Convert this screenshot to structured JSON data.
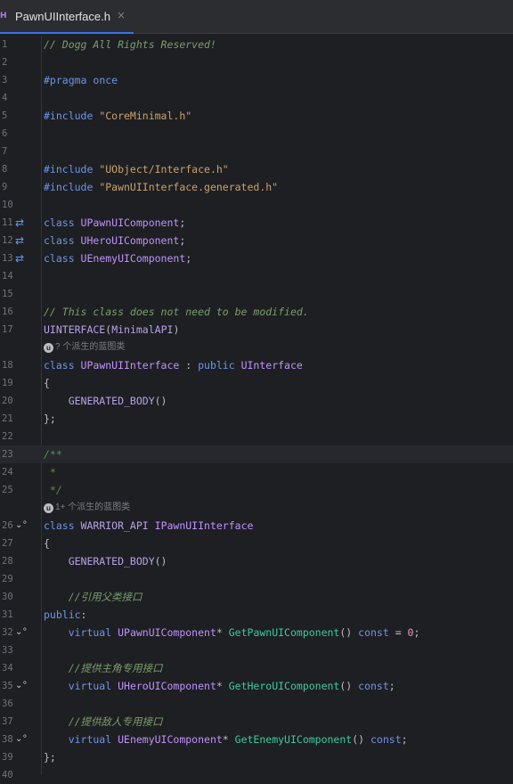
{
  "tab": {
    "icon": "H",
    "file_name": "PawnUIInterface.h",
    "close": "×"
  },
  "inlays": {
    "first": "? 个派生的蓝图类",
    "second": "1+ 个派生的蓝图类"
  },
  "lines": [
    {
      "n": "1"
    },
    {
      "n": "2"
    },
    {
      "n": "3"
    },
    {
      "n": "4"
    },
    {
      "n": "5"
    },
    {
      "n": "6"
    },
    {
      "n": "7"
    },
    {
      "n": "8"
    },
    {
      "n": "9"
    },
    {
      "n": "10"
    },
    {
      "n": "11"
    },
    {
      "n": "12"
    },
    {
      "n": "13"
    },
    {
      "n": "14"
    },
    {
      "n": "15"
    },
    {
      "n": "16"
    },
    {
      "n": "17"
    },
    {
      "n": "18"
    },
    {
      "n": "19"
    },
    {
      "n": "20"
    },
    {
      "n": "21"
    },
    {
      "n": "22"
    },
    {
      "n": "23"
    },
    {
      "n": "24"
    },
    {
      "n": "25"
    },
    {
      "n": "26"
    },
    {
      "n": "27"
    },
    {
      "n": "28"
    },
    {
      "n": "29"
    },
    {
      "n": "30"
    },
    {
      "n": "31"
    },
    {
      "n": "32"
    },
    {
      "n": "33"
    },
    {
      "n": "34"
    },
    {
      "n": "35"
    },
    {
      "n": "36"
    },
    {
      "n": "37"
    },
    {
      "n": "38"
    },
    {
      "n": "39"
    },
    {
      "n": "40"
    }
  ],
  "code": {
    "l1": "// Dogg All Rights Reserved!",
    "l3a": "#pragma",
    "l3b": " once",
    "l5a": "#include",
    "l5b": " \"CoreMinimal.h\"",
    "l8a": "#include",
    "l8b": " \"UObject/Interface.h\"",
    "l9a": "#include",
    "l9b": " \"PawnUIInterface.generated.h\"",
    "l11a": "class",
    "l11b": " UPawnUIComponent",
    "l11c": ";",
    "l12a": "class",
    "l12b": " UHeroUIComponent",
    "l12c": ";",
    "l13a": "class",
    "l13b": " UEnemyUIComponent",
    "l13c": ";",
    "l16": "// This class does not need to be modified.",
    "l17a": "UINTERFACE",
    "l17b": "(",
    "l17c": "MinimalAPI",
    "l17d": ")",
    "l18a": "class",
    "l18b": " UPawnUIInterface",
    "l18c": " : ",
    "l18d": "public",
    "l18e": " UInterface",
    "l19": "{",
    "l20a": "    GENERATED_BODY",
    "l20b": "()",
    "l21": "};",
    "l23": "/**",
    "l24": " *",
    "l25": " */",
    "l26a": "class",
    "l26b": " WARRIOR_API",
    "l26c": " IPawnUIInterface",
    "l27": "{",
    "l28a": "    GENERATED_BODY",
    "l28b": "()",
    "l30": "    //引用父类接口",
    "l31a": "public",
    "l31b": ":",
    "l32a": "    virtual",
    "l32b": " UPawnUIComponent",
    "l32c": "* ",
    "l32d": "GetPawnUIComponent",
    "l32e": "() ",
    "l32f": "const",
    "l32g": " = ",
    "l32h": "0",
    "l32i": ";",
    "l34": "    //提供主角专用接口",
    "l35a": "    virtual",
    "l35b": " UHeroUIComponent",
    "l35c": "* ",
    "l35d": "GetHeroUIComponent",
    "l35e": "() ",
    "l35f": "const",
    "l35g": ";",
    "l37": "    //提供敌人专用接口",
    "l38a": "    virtual",
    "l38b": " UEnemyUIComponent",
    "l38c": "* ",
    "l38d": "GetEnemyUIComponent",
    "l38e": "() ",
    "l38f": "const",
    "l38g": ";",
    "l39": "};"
  },
  "colors": {
    "background": "#1e1f22",
    "accent": "#3574f0",
    "comment": "#7a9e6d",
    "keyword": "#6c95eb",
    "string": "#c9a26d"
  }
}
